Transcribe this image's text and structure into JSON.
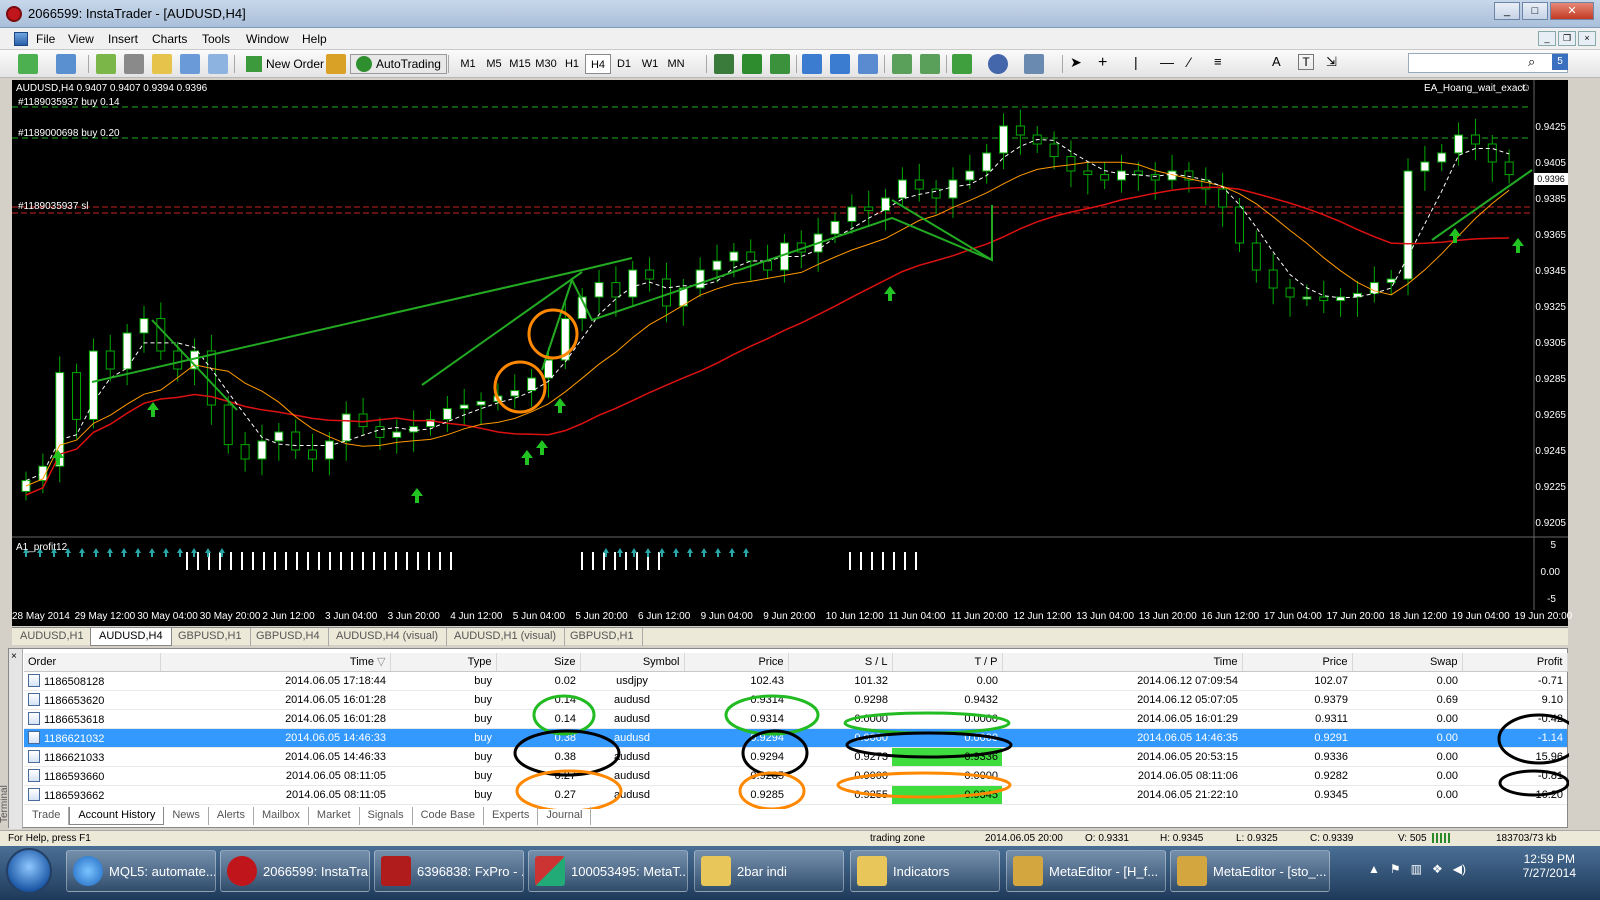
{
  "window": {
    "title": "2066599: InstaTrader - [AUDUSD,H4]",
    "buttons": [
      "_",
      "□",
      "✕"
    ]
  },
  "menu": [
    "File",
    "View",
    "Insert",
    "Charts",
    "Tools",
    "Window",
    "Help"
  ],
  "toolbar": {
    "new_order": "New Order",
    "autotrading": "AutoTrading",
    "timeframes": [
      "M1",
      "M5",
      "M15",
      "M30",
      "H1",
      "H4",
      "D1",
      "W1",
      "MN"
    ],
    "active_timeframe": "H4",
    "text_tool": "A"
  },
  "chart": {
    "symbol_info": "AUDUSD,H4  0.9407 0.9407 0.9394 0.9396",
    "ea_name": "EA_Hoang_wait_exact",
    "order_lines": [
      "#1189035937 buy 0.14",
      "#1189000698 buy 0.20",
      "#1189035937 sl"
    ],
    "price_axis": [
      "0.9425",
      "0.9405",
      "0.9385",
      "0.9365",
      "0.9345",
      "0.9325",
      "0.9305",
      "0.9285",
      "0.9265",
      "0.9245",
      "0.9225",
      "0.9205"
    ],
    "current_price": "0.9396",
    "indicator_name": "A1_profit12",
    "indicator_axis": [
      "5",
      "0.00",
      "-5"
    ],
    "time_axis": [
      "28 May 2014",
      "29 May 12:00",
      "30 May 04:00",
      "30 May 20:00",
      "2 Jun 12:00",
      "3 Jun 04:00",
      "3 Jun 20:00",
      "4 Jun 12:00",
      "5 Jun 04:00",
      "5 Jun 20:00",
      "6 Jun 12:00",
      "9 Jun 04:00",
      "9 Jun 20:00",
      "10 Jun 12:00",
      "11 Jun 04:00",
      "11 Jun 20:00",
      "12 Jun 12:00",
      "13 Jun 04:00",
      "13 Jun 20:00",
      "16 Jun 12:00",
      "17 Jun 04:00",
      "17 Jun 20:00",
      "18 Jun 12:00",
      "19 Jun 04:00",
      "19 Jun 20:00"
    ]
  },
  "chart_tabs": [
    "AUDUSD,H1",
    "AUDUSD,H4",
    "GBPUSD,H1",
    "GBPUSD,H4",
    "AUDUSD,H4 (visual)",
    "AUDUSD,H1 (visual)",
    "GBPUSD,H1"
  ],
  "active_chart_tab": "AUDUSD,H4",
  "terminal": {
    "side_label": "Terminal",
    "close": "×",
    "columns": [
      "Order",
      "Time",
      "Type",
      "Size",
      "Symbol",
      "Price",
      "S / L",
      "T / P",
      "Time",
      "Price",
      "Swap",
      "Profit"
    ],
    "sort_indicator": "▽",
    "rows": [
      {
        "order": "1186508128",
        "time": "2014.06.05 17:18:44",
        "type": "buy",
        "size": "0.02",
        "symbol": "usdjpy",
        "price": "102.43",
        "sl": "101.32",
        "tp": "0.00",
        "close_time": "2014.06.12 07:09:54",
        "close_price": "102.07",
        "swap": "0.00",
        "profit": "-0.71"
      },
      {
        "order": "1186653620",
        "time": "2014.06.05 16:01:28",
        "type": "buy",
        "size": "0.14",
        "symbol": "audusd",
        "price": "0.9314",
        "sl": "0.9298",
        "tp": "0.9432",
        "close_time": "2014.06.12 05:07:05",
        "close_price": "0.9379",
        "swap": "0.69",
        "profit": "9.10"
      },
      {
        "order": "1186653618",
        "time": "2014.06.05 16:01:28",
        "type": "buy",
        "size": "0.14",
        "symbol": "audusd",
        "price": "0.9314",
        "sl": "0.0000",
        "tp": "0.0000",
        "close_time": "2014.06.05 16:01:29",
        "close_price": "0.9311",
        "swap": "0.00",
        "profit": "-0.42"
      },
      {
        "order": "1186621032",
        "time": "2014.06.05 14:46:33",
        "type": "buy",
        "size": "0.38",
        "symbol": "audusd",
        "price": "0.9294",
        "sl": "0.0000",
        "tp": "0.0000",
        "close_time": "2014.06.05 14:46:35",
        "close_price": "0.9291",
        "swap": "0.00",
        "profit": "-1.14"
      },
      {
        "order": "1186621033",
        "time": "2014.06.05 14:46:33",
        "type": "buy",
        "size": "0.38",
        "symbol": "audusd",
        "price": "0.9294",
        "sl": "0.9273",
        "tp": "0.9336",
        "close_time": "2014.06.05 20:53:15",
        "close_price": "0.9336",
        "swap": "0.00",
        "profit": "15.96"
      },
      {
        "order": "1186593660",
        "time": "2014.06.05 08:11:05",
        "type": "buy",
        "size": "0.27",
        "symbol": "audusd",
        "price": "0.9285",
        "sl": "0.0000",
        "tp": "0.0000",
        "close_time": "2014.06.05 08:11:06",
        "close_price": "0.9282",
        "swap": "0.00",
        "profit": "-0.81"
      },
      {
        "order": "1186593662",
        "time": "2014.06.05 08:11:05",
        "type": "buy",
        "size": "0.27",
        "symbol": "audusd",
        "price": "0.9285",
        "sl": "0.9255",
        "tp": "0.9345",
        "close_time": "2014.06.05 21:22:10",
        "close_price": "0.9345",
        "swap": "0.00",
        "profit": "16.20"
      }
    ],
    "tabs": [
      "Trade",
      "Account History",
      "News",
      "Alerts",
      "Mailbox",
      "Market",
      "Signals",
      "Code Base",
      "Experts",
      "Journal"
    ],
    "active_tab": "Account History"
  },
  "status": {
    "help": "For Help, press F1",
    "zone": "trading zone",
    "datetime": "2014.06.05 20:00",
    "open": "O: 0.9331",
    "high": "H: 0.9345",
    "low": "L: 0.9325",
    "close": "C: 0.9339",
    "volume": "V: 505",
    "traffic": "183703/73 kb"
  },
  "taskbar": {
    "items": [
      "MQL5: automate...",
      "2066599: InstaTra...",
      "6396838: FxPro - ...",
      "100053495: MetaT...",
      "2bar indi",
      "Indicators",
      "MetaEditor - [H_f...",
      "MetaEditor - [sto_..."
    ],
    "time": "12:59 PM",
    "date": "7/27/2014"
  },
  "colors": {
    "chart_bg": "#000000",
    "bull_candle": "#ffffff",
    "bear_candle": "#00aa00",
    "ma_slow": "#dd1111",
    "ma_mid": "#ff9900",
    "trend_line": "#22aa22",
    "selected_row": "#3399ff",
    "tp_hit": "#3fdc3f",
    "annotation_green": "#22bb22",
    "annotation_orange": "#ff8800",
    "annotation_black": "#000000"
  }
}
